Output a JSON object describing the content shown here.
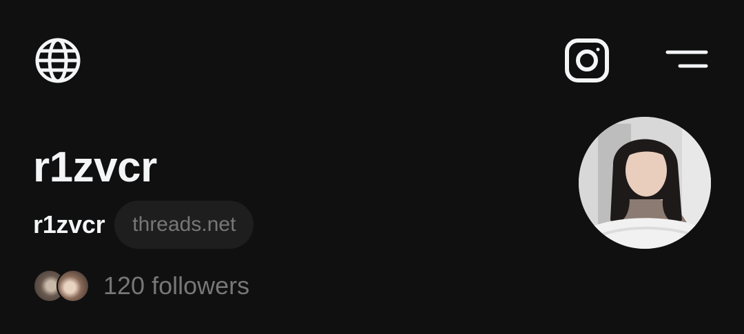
{
  "header": {
    "left_icon": "globe-icon",
    "right_icons": [
      "instagram-icon",
      "menu-icon"
    ]
  },
  "profile": {
    "display_name": "r1zvcr",
    "username": "r1zvcr",
    "domain_chip": "threads.net",
    "followers_text": "120 followers",
    "avatar_image": "profile-photo"
  },
  "colors": {
    "background": "#101010",
    "primary_text": "#f3f5f7",
    "secondary_text": "#777777",
    "chip_background": "#1e1e1e"
  }
}
